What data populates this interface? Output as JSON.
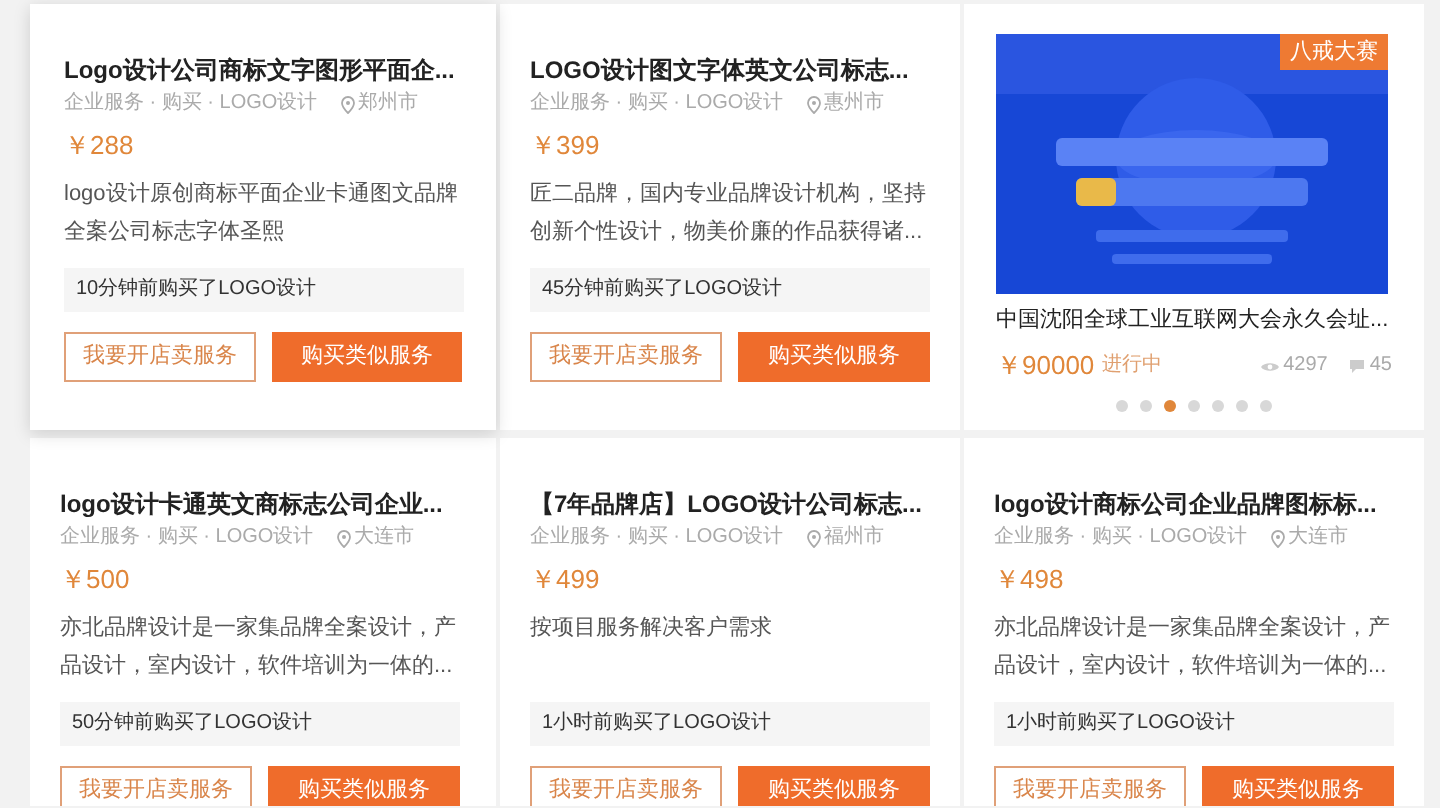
{
  "cards": [
    {
      "kind": "service",
      "hovered": true,
      "title": "Logo设计公司商标文字图形平面企...",
      "meta": "企业服务 · 购买 · LOGO设计",
      "location": "郑州市",
      "price": "￥288",
      "description": "logo设计原创商标平面企业卡通图文品牌全案公司标志字体圣熙",
      "recent": "10分钟前购买了LOGO设计",
      "buttons": [
        "我要开店卖服务",
        "购买类似服务"
      ]
    },
    {
      "kind": "service",
      "hovered": false,
      "title": "LOGO设计图文字体英文公司标志...",
      "meta": "企业服务 · 购买 · LOGO设计",
      "location": "惠州市",
      "price": "￥399",
      "description": "匠二品牌，国内专业品牌设计机构，坚持创新个性设计，物美价廉的作品获得诸...",
      "recent": "45分钟前购买了LOGO设计",
      "buttons": [
        "我要开店卖服务",
        "购买类似服务"
      ]
    },
    {
      "kind": "contest",
      "badge": "八戒大赛",
      "title": "中国沈阳全球工业互联网大会永久会址...",
      "price": "￥90000",
      "status": "进行中",
      "views": "4297",
      "comments": "45",
      "dots": [
        {
          "selected": false
        },
        {
          "selected": false
        },
        {
          "selected": true
        },
        {
          "selected": false
        },
        {
          "selected": false
        },
        {
          "selected": false
        },
        {
          "selected": false
        }
      ]
    },
    {
      "kind": "service",
      "hovered": false,
      "title": "logo设计卡通英文商标志公司企业...",
      "meta": "企业服务 · 购买 · LOGO设计",
      "location": "大连市",
      "price": "￥500",
      "description": "亦北品牌设计是一家集品牌全案设计，产品设计，室内设计，软件培训为一体的...",
      "recent": "50分钟前购买了LOGO设计",
      "buttons": [
        "我要开店卖服务",
        "购买类似服务"
      ]
    },
    {
      "kind": "service",
      "hovered": false,
      "title": "【7年品牌店】LOGO设计公司标志...",
      "meta": "企业服务 · 购买 · LOGO设计",
      "location": "福州市",
      "price": "￥499",
      "description": "按项目服务解决客户需求",
      "recent": "1小时前购买了LOGO设计",
      "buttons": [
        "我要开店卖服务",
        "购买类似服务"
      ]
    },
    {
      "kind": "service",
      "hovered": false,
      "title": "logo设计商标公司企业品牌图标标...",
      "meta": "企业服务 · 购买 · LOGO设计",
      "location": "大连市",
      "price": "￥498",
      "description": "亦北品牌设计是一家集品牌全案设计，产品设计，室内设计，软件培训为一体的...",
      "recent": "1小时前购买了LOGO设计",
      "buttons": [
        "我要开店卖服务",
        "购买类似服务"
      ]
    }
  ]
}
